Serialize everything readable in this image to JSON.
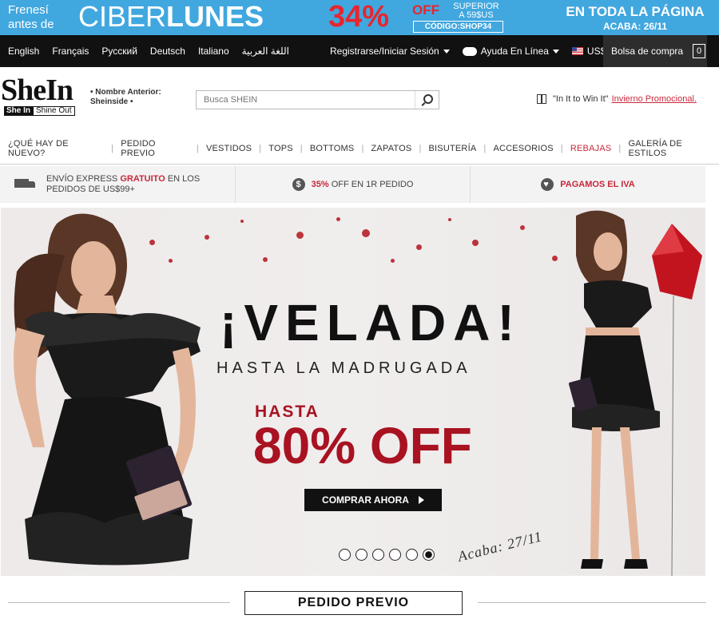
{
  "promo_bar": {
    "left_line1": "Frenesí",
    "left_line2": "antes de",
    "big_light": "CIBER",
    "big_bold": "LUNES",
    "percent": "34%",
    "off": "OFF",
    "superior": "SUPERIOR",
    "superior_amount": "A 59$US",
    "code": "CÓDIGO:SHOP34",
    "right_line1": "EN TODA LA PÁGINA",
    "right_line2": "ACABA: 26/11",
    "color": "#41a7df"
  },
  "top_nav": {
    "languages": [
      "English",
      "Français",
      "Русский",
      "Deutsch",
      "Italiano",
      "اللغة العربية"
    ],
    "account": "Registrarse/Iniciar Sesión",
    "help": "Ayuda En Línea",
    "currency": "US$",
    "bag_label": "Bolsa de compra",
    "bag_count": "0"
  },
  "header": {
    "logo_text": "SheIn",
    "logo_tag_1": "She In",
    "logo_tag_2": "Shine Out",
    "former_line1": "• Nombre Anterior:",
    "former_line2": "Sheinside •",
    "search_placeholder": "Busca SHEIN",
    "promo_text": "\"In It to Win It\"",
    "promo_link": "Invierno Promocional."
  },
  "categories": [
    {
      "label": "¿QUÉ HAY DE NUEVO?",
      "highlight": false
    },
    {
      "label": "PEDIDO PREVIO",
      "highlight": false
    },
    {
      "label": "VESTIDOS",
      "highlight": false
    },
    {
      "label": "TOPS",
      "highlight": false
    },
    {
      "label": "BOTTOMS",
      "highlight": false
    },
    {
      "label": "ZAPATOS",
      "highlight": false
    },
    {
      "label": "BISUTERÍA",
      "highlight": false
    },
    {
      "label": "ACCESORIOS",
      "highlight": false
    },
    {
      "label": "REBAJAS",
      "highlight": true
    },
    {
      "label": "GALERÍA DE ESTILOS",
      "highlight": false
    }
  ],
  "features": {
    "shipping_pre": "ENVÍO EXPRESS",
    "shipping_red": "GRATUITO",
    "shipping_post": "EN LOS",
    "shipping_line2": "PEDIDOS DE US$99+",
    "discount_red": "35%",
    "discount_post": "OFF EN 1R PEDIDO",
    "dollar_icon": "$",
    "iva": "PAGAMOS EL IVA",
    "accent_color": "#c8283c"
  },
  "hero": {
    "title": "¡VELADA!",
    "subtitle": "HASTA LA MADRUGADA",
    "up_to": "HASTA",
    "discount": "80% OFF",
    "button": "COMPRAR AHORA",
    "ends": "Acaba: 27/11",
    "slides_total": 6,
    "active_slide": 6,
    "accent_color": "#a81221"
  },
  "section": {
    "title": "PEDIDO PREVIO"
  }
}
